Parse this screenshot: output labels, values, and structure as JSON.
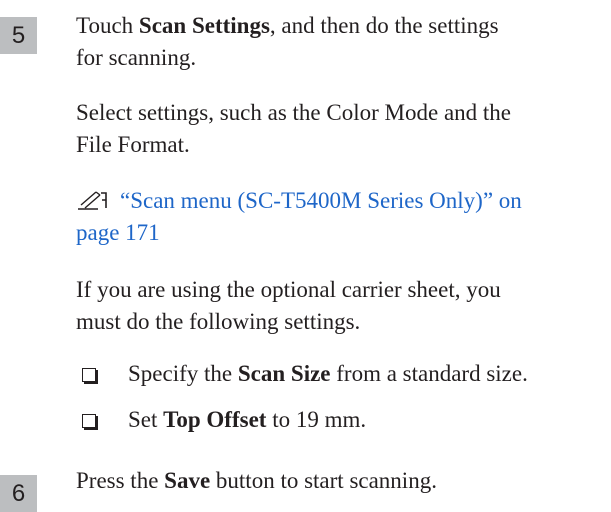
{
  "step5": {
    "number": "5",
    "line1_prefix": "Touch ",
    "line1_bold": "Scan Settings",
    "line1_suffix": ", and then do the settings",
    "line2": "for scanning.",
    "para1_line1": "Select settings, such as the Color Mode and the",
    "para1_line2": "File Format.",
    "ref_icon": "pencil-reference-icon",
    "ref_line1": "“Scan menu (SC-T5400M Series Only)” on",
    "ref_line2": "page 171",
    "para2_line1": "If you are using the optional carrier sheet, you",
    "para2_line2": "must do the following settings.",
    "bullets": [
      {
        "prefix": "Specify the ",
        "bold": "Scan Size",
        "suffix": " from a standard size."
      },
      {
        "prefix": "Set ",
        "bold": "Top Offset",
        "suffix": " to 19 mm."
      }
    ]
  },
  "step6": {
    "number": "6",
    "prefix": "Press the ",
    "bold": "Save",
    "suffix": " button to start scanning."
  },
  "colors": {
    "link": "#1e66c8",
    "badge": "#bcbec0",
    "text": "#231f20"
  }
}
